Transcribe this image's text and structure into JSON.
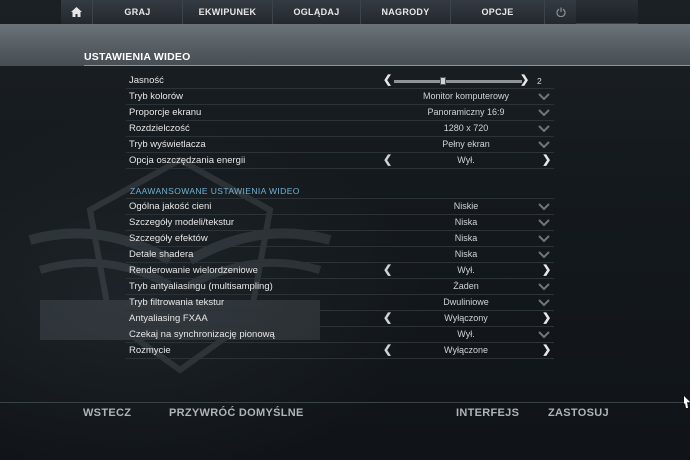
{
  "nav": {
    "items": [
      {
        "label": "GRAJ"
      },
      {
        "label": "EKWIPUNEK"
      },
      {
        "label": "OGLĄDAJ"
      },
      {
        "label": "NAGRODY"
      },
      {
        "label": "OPCJE"
      }
    ]
  },
  "page": {
    "title": "USTAWIENIA WIDEO"
  },
  "brightness": {
    "label": "Jasność",
    "value": "2",
    "level": 0.38
  },
  "basic": [
    {
      "label": "Tryb kolorów",
      "value": "Monitor komputerowy",
      "control": "dropdown"
    },
    {
      "label": "Proporcje ekranu",
      "value": "Panoramiczny 16:9",
      "control": "dropdown"
    },
    {
      "label": "Rozdzielczość",
      "value": "1280 x 720",
      "control": "dropdown"
    },
    {
      "label": "Tryb wyświetlacza",
      "value": "Pełny ekran",
      "control": "dropdown"
    },
    {
      "label": "Opcja oszczędzania energii",
      "value": "Wył.",
      "control": "arrows"
    }
  ],
  "advanced_title": "ZAAWANSOWANE USTAWIENIA WIDEO",
  "advanced": [
    {
      "label": "Ogólna jakość cieni",
      "value": "Niskie",
      "control": "dropdown"
    },
    {
      "label": "Szczegóły modeli/tekstur",
      "value": "Niska",
      "control": "dropdown"
    },
    {
      "label": "Szczegóły efektów",
      "value": "Niska",
      "control": "dropdown"
    },
    {
      "label": "Detale shadera",
      "value": "Niska",
      "control": "dropdown"
    },
    {
      "label": "Renderowanie wielordzeniowe",
      "value": "Wył.",
      "control": "arrows"
    },
    {
      "label": "Tryb antyaliasingu (multisampling)",
      "value": "Żaden",
      "control": "dropdown"
    },
    {
      "label": "Tryb filtrowania tekstur",
      "value": "Dwuliniowe",
      "control": "dropdown"
    },
    {
      "label": "Antyaliasing FXAA",
      "value": "Wyłączony",
      "control": "arrows"
    },
    {
      "label": "Czekaj na synchronizację pionową",
      "value": "Wył.",
      "control": "dropdown"
    },
    {
      "label": "Rozmycie",
      "value": "Wyłączone",
      "control": "arrows"
    }
  ],
  "bottom": {
    "back": "WSTECZ",
    "reset": "PRZYWRÓĆ DOMYŚLNE",
    "interface": "INTERFEJS",
    "apply": "ZASTOSUJ"
  },
  "icons": {
    "home": "home-icon",
    "power": "power-icon",
    "arrow_left": "chevron-left-icon",
    "arrow_right": "chevron-right-icon",
    "dropdown": "chevron-down-icon"
  },
  "colors": {
    "accent": "#6fb3d2",
    "header_strip": "#5a6166"
  }
}
